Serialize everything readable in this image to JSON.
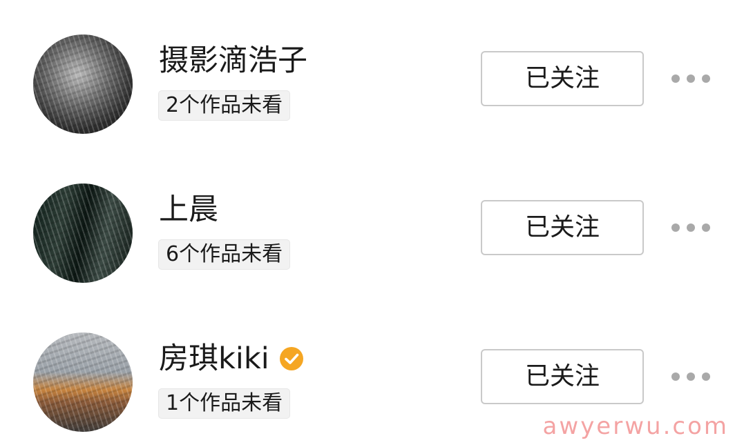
{
  "accounts": [
    {
      "name": "摄影滴浩子",
      "unseen_works": "2个作品未看",
      "follow_label": "已关注",
      "verified": false
    },
    {
      "name": "上晨",
      "unseen_works": "6个作品未看",
      "follow_label": "已关注",
      "verified": false
    },
    {
      "name": "房琪kiki",
      "unseen_works": "1个作品未看",
      "follow_label": "已关注",
      "verified": true
    }
  ],
  "colors": {
    "verified_badge": "#f5a623",
    "more_dots": "#a9a9a9",
    "watermark": "#f4a3a3"
  },
  "icons": {
    "more": "more-dots-icon",
    "verified": "verified-check-icon"
  },
  "watermark": "awyerwu.com"
}
